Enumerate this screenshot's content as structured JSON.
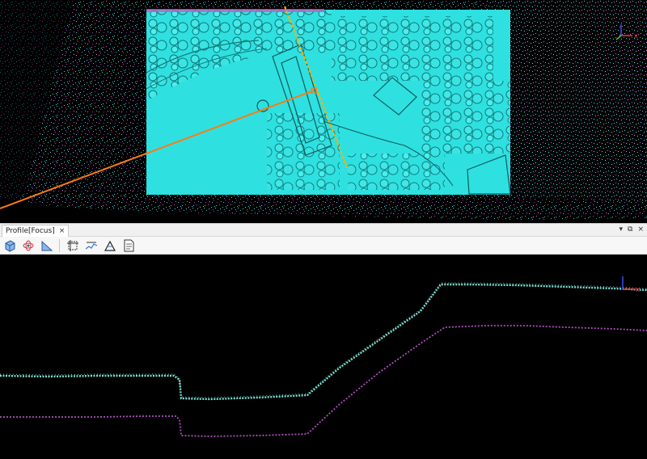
{
  "profile_panel": {
    "tab_title": "Profile[Focus]",
    "tab_close": "×",
    "window_controls": [
      "▾",
      "⧉",
      "×"
    ]
  },
  "toolbar": {
    "buttons": [
      {
        "icon": "3d-cube-icon"
      },
      {
        "icon": "orbit-icon"
      },
      {
        "icon": "triangle-slope-icon"
      },
      {
        "icon": "crop-frame-icon"
      },
      {
        "icon": "profile-measure-icon"
      },
      {
        "icon": "terrain-triangle-icon"
      },
      {
        "icon": "report-document-icon"
      }
    ]
  },
  "top_view": {
    "axis_label_x": "x",
    "colors": {
      "cyan": "#2ee6e6",
      "magenta": "#d060d0",
      "section_line": "#ff8c1a",
      "dashed_line": "#ffb000"
    }
  },
  "profile_view": {
    "axis_label_x": "x",
    "colors": {
      "upper_surface": "#7fe0d4",
      "lower_surface": "#b050c0"
    }
  }
}
